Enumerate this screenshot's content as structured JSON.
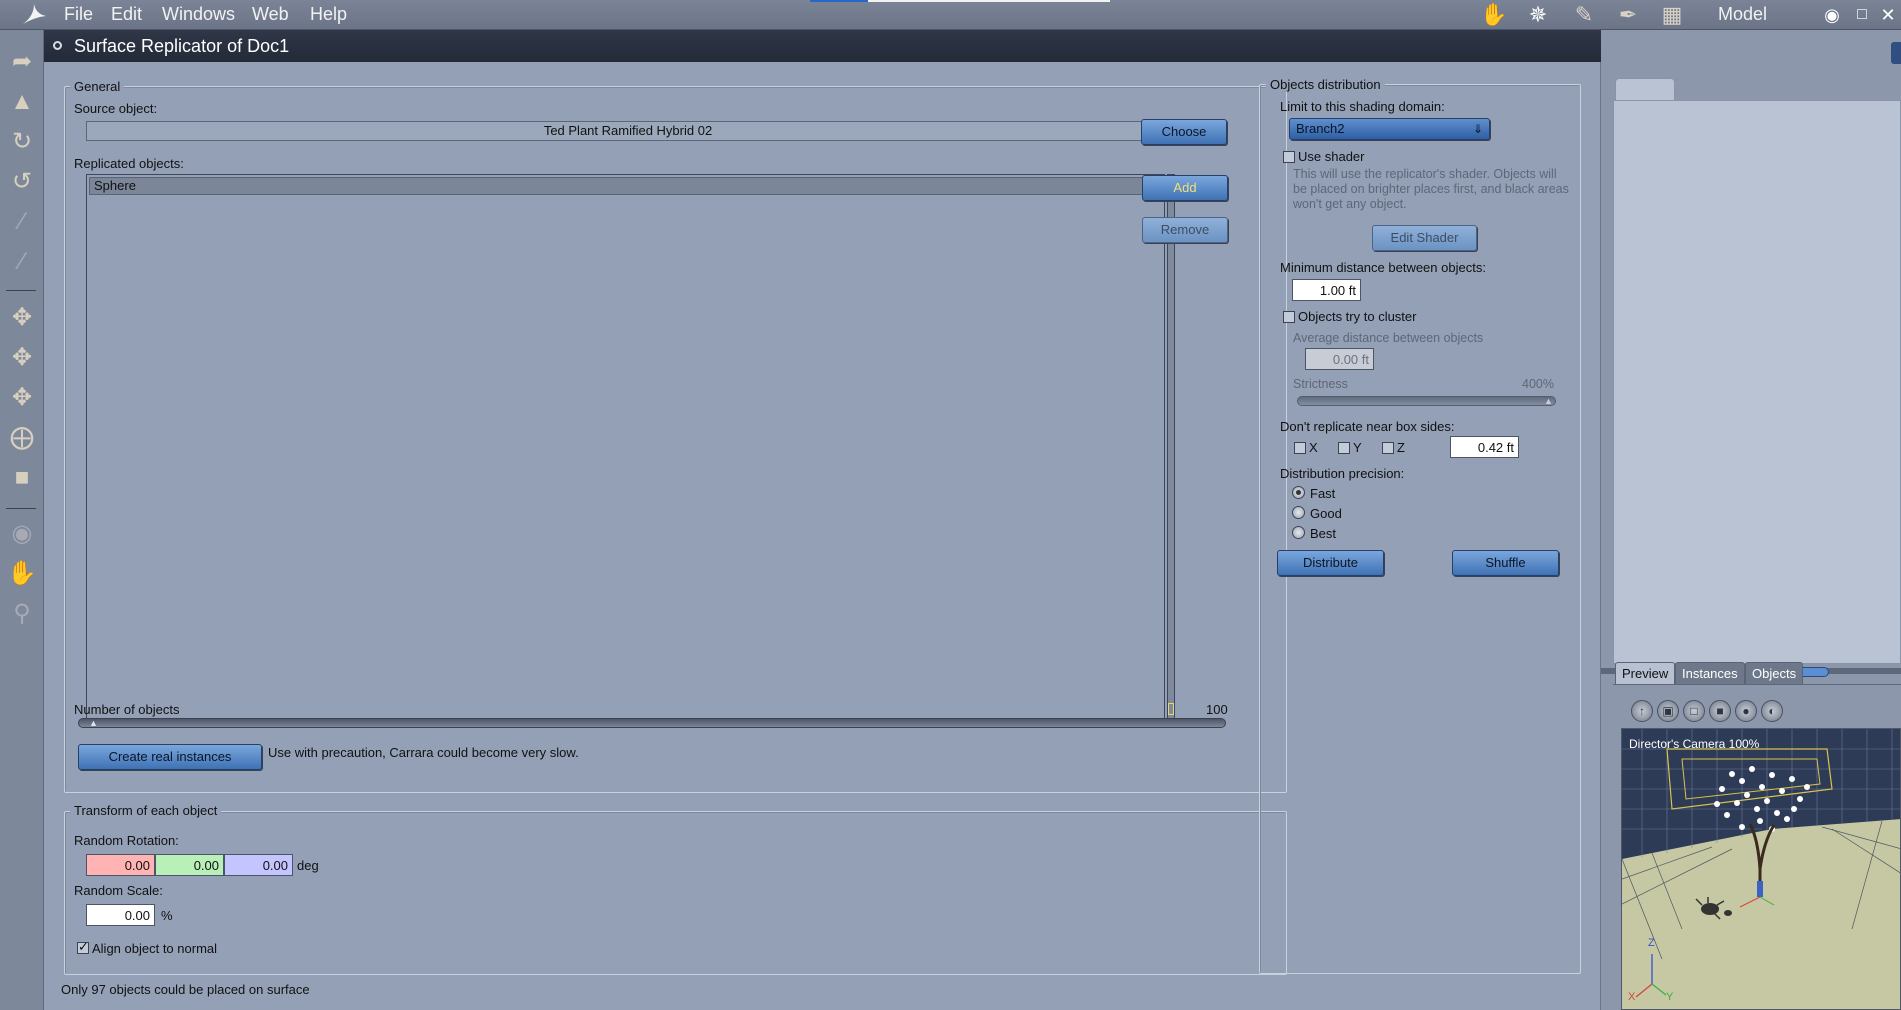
{
  "menubar": {
    "items": [
      "File",
      "Edit",
      "Windows",
      "Web",
      "Help"
    ],
    "room_label": "Model"
  },
  "dialog": {
    "title": "Surface Replicator of Doc1",
    "general": {
      "legend": "General",
      "source_label": "Source object:",
      "source_value": "Ted Plant Ramified Hybrid 02",
      "choose_button": "Choose",
      "replicated_label": "Replicated objects:",
      "replicated_items": [
        "Sphere"
      ],
      "add_button": "Add",
      "remove_button": "Remove",
      "number_label": "Number of objects",
      "number_max": "100",
      "create_instances_button": "Create real instances",
      "precaution_text": "Use with precaution, Carrara could become very slow."
    },
    "transform": {
      "legend": "Transform of each object",
      "rotation_label": "Random Rotation:",
      "rotation_x": "0.00",
      "rotation_y": "0.00",
      "rotation_z": "0.00",
      "rotation_unit": "deg",
      "scale_label": "Random Scale:",
      "scale_value": "0.00",
      "scale_unit": "%",
      "align_label": "Align object to normal",
      "align_checked": true
    },
    "status": "Only 97 objects could be placed on surface",
    "distribution": {
      "legend": "Objects distribution",
      "domain_label": "Limit to this shading domain:",
      "domain_value": "Branch2",
      "use_shader_label": "Use shader",
      "shader_desc": "This will use the replicator's shader. Objects will be placed on brighter places first, and black areas won't get any object.",
      "edit_shader_button": "Edit Shader",
      "min_distance_label": "Minimum distance between objects:",
      "min_distance_value": "1.00 ft",
      "cluster_label": "Objects try to cluster",
      "avg_distance_label": "Average distance between objects",
      "avg_distance_value": "0.00 ft",
      "strictness_label": "Strictness",
      "strictness_value": "400%",
      "box_sides_label": "Don't replicate near box sides:",
      "axis_x": "X",
      "axis_y": "Y",
      "axis_z": "Z",
      "box_distance_value": "0.42 ft",
      "precision_label": "Distribution precision:",
      "precision_options": [
        "Fast",
        "Good",
        "Best"
      ],
      "precision_selected": "Fast",
      "distribute_button": "Distribute",
      "shuffle_button": "Shuffle"
    }
  },
  "right_panel": {
    "tabs": [
      "Preview",
      "Instances",
      "Objects"
    ],
    "active_tab": "Preview",
    "viewport_label": "Director's Camera 100%",
    "axis_z": "Z",
    "axis_x": "X",
    "axis_y": "Y"
  },
  "colors": {
    "rotation_x_bg": "#ffb3b3",
    "rotation_y_bg": "#b8f0b8",
    "rotation_z_bg": "#c4c4ff",
    "dialog_bg": "#93a0b6",
    "title_bar": "#232a38"
  }
}
